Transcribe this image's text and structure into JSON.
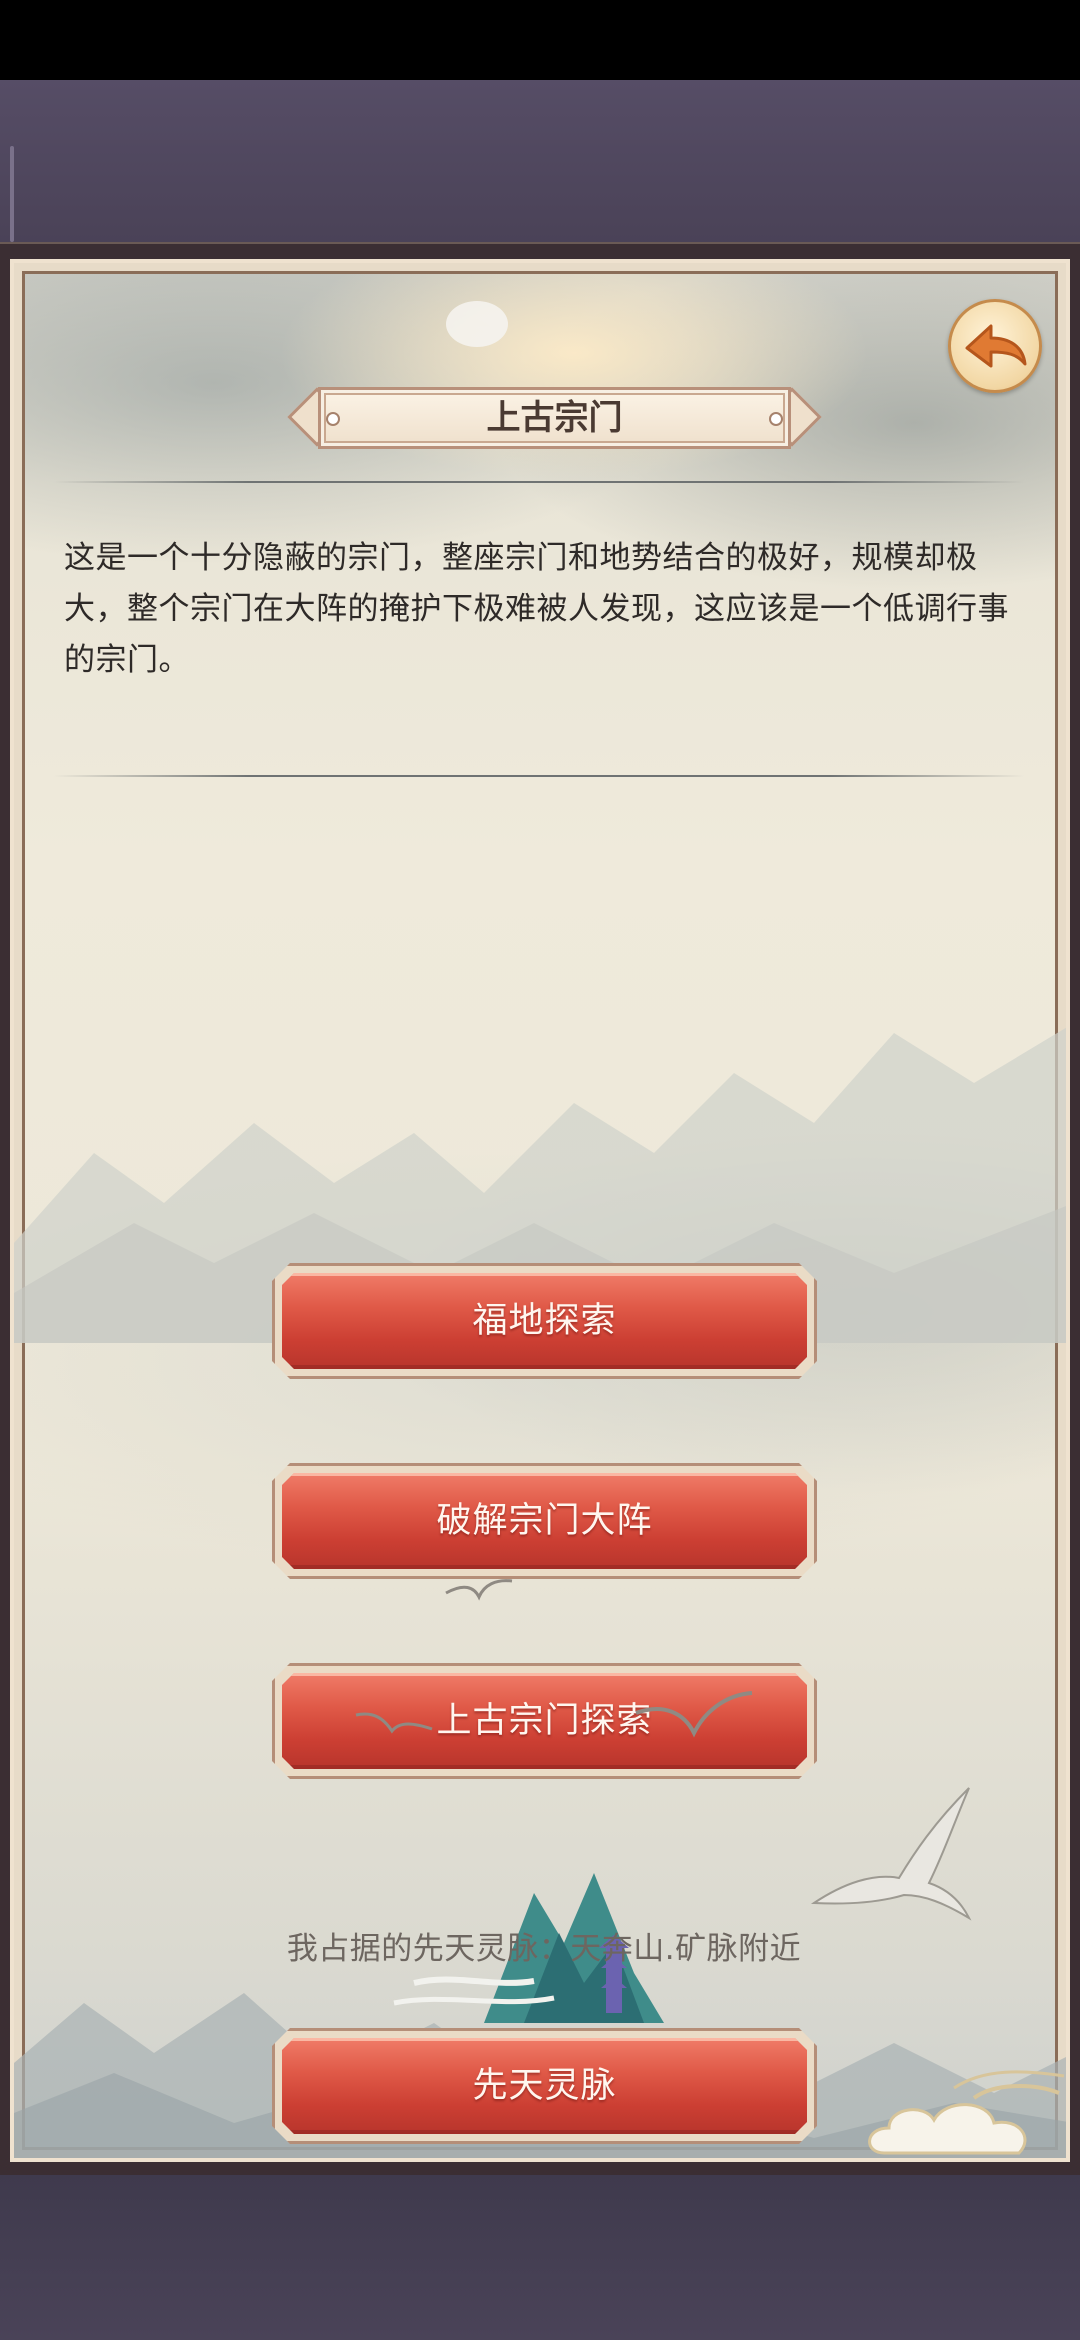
{
  "header": {
    "title": "上古宗门",
    "back_icon": "back-arrow-icon"
  },
  "description": "这是一个十分隐蔽的宗门，整座宗门和地势结合的极好，规模却极大，整个宗门在大阵的掩护下极难被人发现，这应该是一个低调行事的宗门。",
  "actions": [
    {
      "label": "福地探索"
    },
    {
      "label": "破解宗门大阵"
    },
    {
      "label": "上古宗门探索"
    },
    {
      "label": "先天灵脉"
    }
  ],
  "spirit_vein_info": "我占据的先天灵脉：天奔山.矿脉附近",
  "colors": {
    "button_red": "#d94a3c",
    "frame_cream": "#efe2cf",
    "back_button_gold": "#f2d7a4",
    "back_arrow": "#e07a33"
  }
}
